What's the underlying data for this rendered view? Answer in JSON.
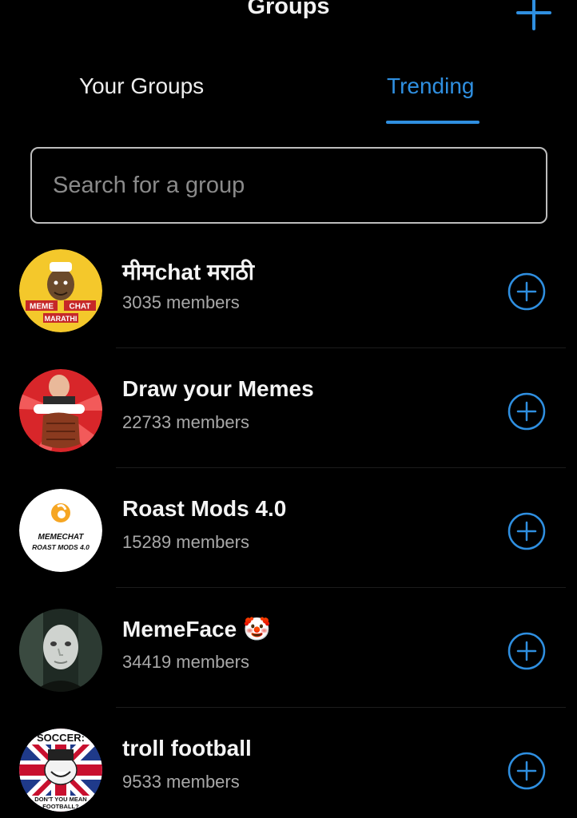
{
  "header": {
    "title": "Groups",
    "add_icon": "plus-icon"
  },
  "tabs": [
    {
      "label": "Your Groups",
      "active": false
    },
    {
      "label": "Trending",
      "active": true
    }
  ],
  "search": {
    "placeholder": "Search for a group",
    "value": ""
  },
  "groups": [
    {
      "name": "मीमchat मराठी",
      "members": "3035 members",
      "avatar_text_1": "MEME",
      "avatar_text_2": "CHAT",
      "avatar_text_3": "MARATHI"
    },
    {
      "name": "Draw your Memes",
      "members": "22733 members"
    },
    {
      "name": "Roast Mods 4.0",
      "members": "15289 members",
      "avatar_text_1": "MEMECHAT",
      "avatar_text_2": "ROAST MODS 4.0"
    },
    {
      "name": "MemeFace 🤡",
      "members": "34419 members"
    },
    {
      "name": "troll football",
      "members": "9533 members",
      "avatar_text_1": "SOCCER:",
      "avatar_text_2": "DON'T YOU MEAN",
      "avatar_text_3": "FOOTBALL?"
    }
  ],
  "colors": {
    "background": "#000000",
    "accent": "#2f8fe0",
    "text_primary": "#f4f4f4",
    "text_secondary": "#a8a8a8"
  }
}
